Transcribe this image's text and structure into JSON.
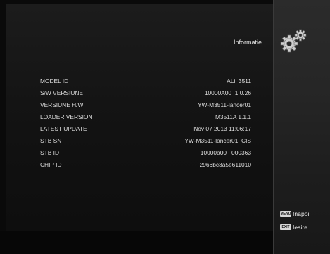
{
  "header": {
    "title": "Informatie"
  },
  "info_rows": [
    {
      "label": "MODEL ID",
      "value": "ALi_3511"
    },
    {
      "label": "S/W VERSIUNE",
      "value": "10000A00_1.0.26"
    },
    {
      "label": "VERSIUNE H/W",
      "value": "YW-M3511-lancer01"
    },
    {
      "label": "LOADER VERSION",
      "value": "M3511A 1.1.1"
    },
    {
      "label": "LATEST UPDATE",
      "value": "Nov 07 2013 11:06:17"
    },
    {
      "label": "STB SN",
      "value": "YW-M3511-lancer01_CIS"
    },
    {
      "label": "STB ID",
      "value": "10000a00 : 000363"
    },
    {
      "label": "CHIP ID",
      "value": "2966bc3a5e611010"
    }
  ],
  "help": {
    "menu_key": "MENU",
    "menu_label": "Inapoi",
    "exit_key": "EXIT",
    "exit_label": "Iesire"
  },
  "icons": {
    "header_icon": "gears-icon"
  }
}
